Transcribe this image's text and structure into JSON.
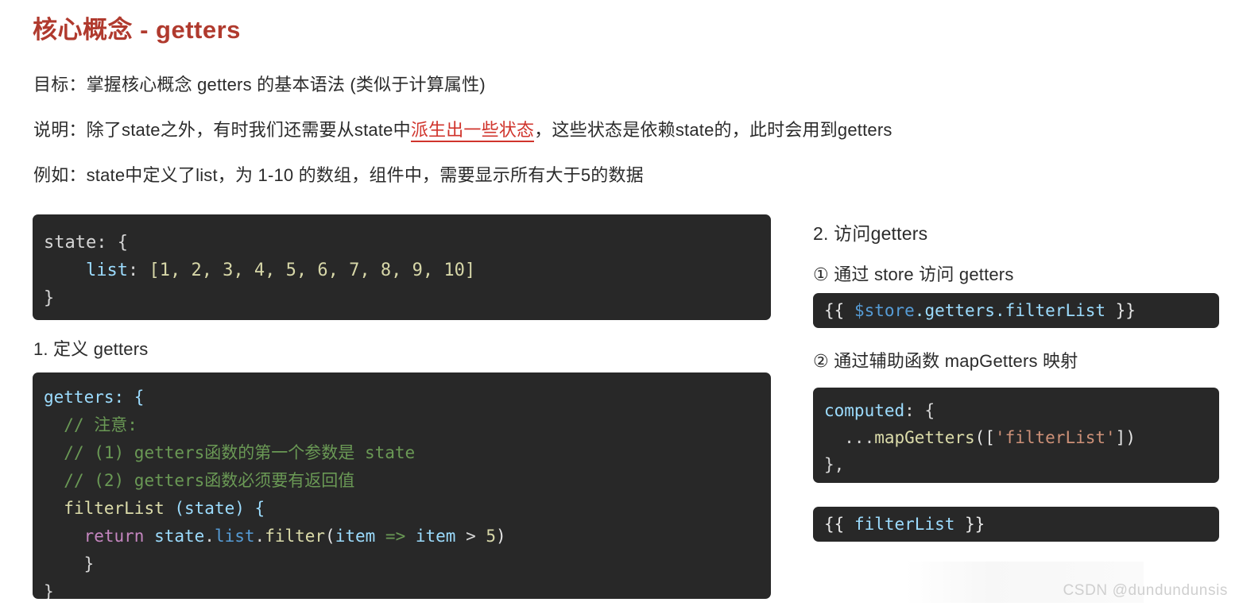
{
  "title": "核心概念 - getters",
  "intro": {
    "goal_label": "目标：",
    "goal_text": "掌握核心概念 getters 的基本语法 (类似于计算属性)",
    "desc_label": "说明：",
    "desc_before": "除了state之外，有时我们还需要从state中",
    "desc_highlight": "派生出一些状态",
    "desc_after": "，这些状态是依赖state的，此时会用到getters",
    "example_label": "例如：",
    "example_text": "state中定义了list，为 1-10 的数组，组件中，需要显示所有大于5的数据"
  },
  "headings": {
    "define_getters": "1. 定义 getters",
    "access_getters": "2. 访问getters",
    "via_store": "① 通过 store 访问 getters",
    "via_map_getters": "② 通过辅助函数 mapGetters 映射"
  },
  "code_state": {
    "line1_key": "state: {",
    "line2_indent": "    ",
    "line2_prop": "list",
    "line2_colon": ": ",
    "line2_value": "[1, 2, 3, 4, 5, 6, 7, 8, 9, 10]",
    "line3": "}"
  },
  "code_getters": {
    "l1": "getters: {",
    "l2_comment": "// 注意:",
    "l3_comment": "// (1) getters函数的第一个参数是 state",
    "l4_comment": "// (2) getters函数必须要有返回值",
    "l5_fn": "filterList",
    "l5_params": " (state) {",
    "l6_return": "return",
    "l6_obj": " state",
    "l6_dot1": ".",
    "l6_list": "list",
    "l6_dot2": ".",
    "l6_filter": "filter",
    "l6_open": "(",
    "l6_item1": "item",
    "l6_arrow": " => ",
    "l6_item2": "item",
    "l6_gt": " > ",
    "l6_num": "5",
    "l6_close": ")",
    "l7": "  }",
    "l8": "}"
  },
  "code_store_access": {
    "open": "{{ ",
    "store": "$store",
    "path": ".getters.filterList",
    "close": " }}"
  },
  "code_computed": {
    "l1_key": "computed",
    "l1_rest": ": {",
    "l2_spread": "  ...",
    "l2_fn": "mapGetters",
    "l2_open": "([",
    "l2_str": "'filterList'",
    "l2_close": "])",
    "l3": "},"
  },
  "code_interp": {
    "open": "{{ ",
    "name": "filterList",
    "close": " }}"
  },
  "watermark": "CSDN @dundundunsis",
  "colors": {
    "title_red": "#b03a2e",
    "highlight_red": "#d0342c",
    "code_bg": "#282828",
    "token_blue": "#9cdcfe",
    "token_green": "#6a9955",
    "token_khaki": "#dcdcaa",
    "token_pink": "#c586c0",
    "token_salmon": "#ce9178"
  }
}
